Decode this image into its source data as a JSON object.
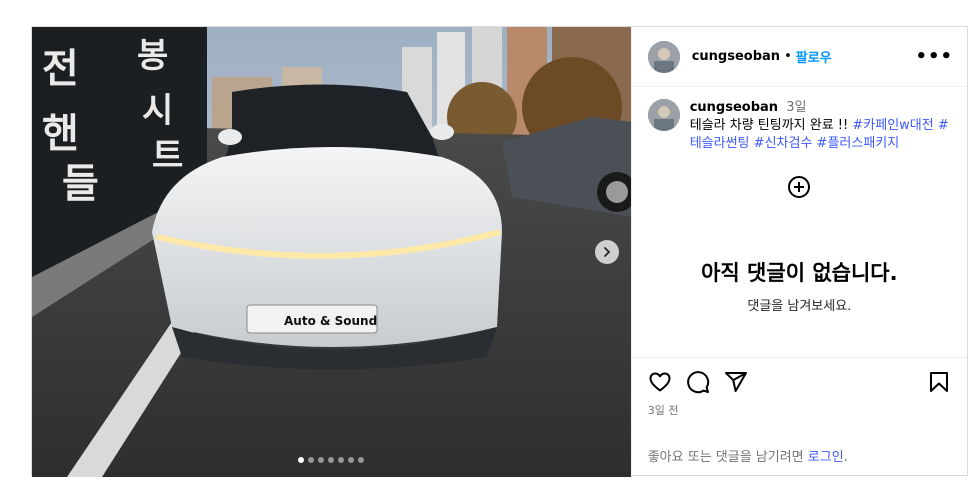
{
  "post": {
    "username": "cungseoban",
    "separator": "•",
    "follow_label": "팔로우",
    "more_label": "•••"
  },
  "media": {
    "plate_text": "Auto & Sound",
    "storefront_text": "전 핸 들 봉 퉁 시 트",
    "image_count": 7,
    "active_index": 0
  },
  "caption": {
    "username": "cungseoban",
    "time": "3일",
    "text": "테슬라 차량 틴팅까지 완료 !! ",
    "hashtags": [
      "#카페인w대전",
      "#테슬라썬팅",
      "#신차검수",
      "#플러스패키지"
    ]
  },
  "comments": {
    "empty_title": "아직 댓글이 없습니다.",
    "empty_subtitle": "댓글을 남겨보세요."
  },
  "actions": {
    "date": "3일 전",
    "login_prefix": "좋아요 또는 댓글을 남기려면 ",
    "login_link": "로그인",
    "login_suffix": "."
  },
  "icons": [
    "heart-icon",
    "comment-icon",
    "share-icon",
    "bookmark-icon",
    "add-comment-icon",
    "chevron-right-icon"
  ]
}
